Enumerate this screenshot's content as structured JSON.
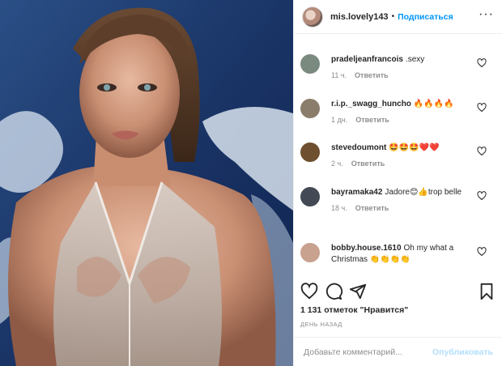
{
  "header": {
    "username": "mis.lovely143",
    "separator": "•",
    "follow_label": "Подписаться",
    "more_icon": "···"
  },
  "comments": [
    {
      "username": "pradeljeanfrancois",
      "text": ".sexy",
      "time": "11 ч.",
      "reply": "Ответить",
      "avatar_color": "#7a8a7f"
    },
    {
      "username": "r.i.p._swagg_huncho",
      "text": "🔥🔥🔥🔥",
      "time": "1 дн.",
      "reply": "Ответить",
      "avatar_color": "#8b7d6b"
    },
    {
      "username": "stevedoumont",
      "text": "🤩🤩🤩❤️❤️",
      "time": "2 ч.",
      "reply": "Ответить",
      "avatar_color": "#6e4f2f"
    },
    {
      "username": "bayramaka42",
      "text": "Jadore😊👍trop belle",
      "time": "18 ч.",
      "reply": "Ответить",
      "avatar_color": "#444a55"
    },
    {
      "username": "bobby.house.1610",
      "text": "Oh my what a Christmas 👏👏👏👏",
      "time": "",
      "reply": "",
      "avatar_color": "#c9a18f"
    }
  ],
  "likes": "1 131 отметок \"Нравится\"",
  "date": "ДЕНЬ НАЗАД",
  "add_comment": {
    "placeholder": "Добавьте комментарий...",
    "post_label": "Опубликовать"
  },
  "icons": [
    "heart-icon",
    "comment-icon",
    "share-icon",
    "bookmark-icon"
  ]
}
